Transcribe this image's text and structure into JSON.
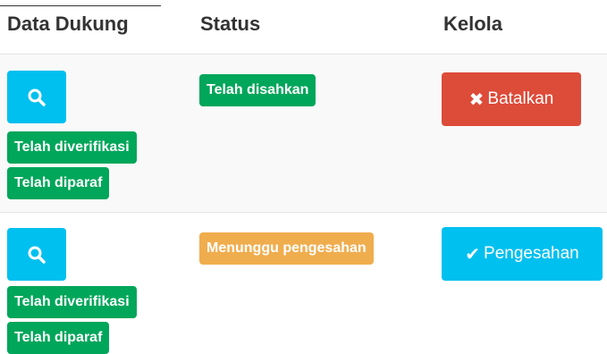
{
  "table": {
    "headers": [
      "Data Dukung",
      "Status",
      "Kelola"
    ],
    "rows": [
      {
        "verification_badges": [
          "Telah diverifikasi",
          "Telah diparaf"
        ],
        "status": "Telah disahkan",
        "status_color": "#00a65a",
        "action_label": "Batalkan",
        "action_icon": "times-icon",
        "action_color": "#dd4b39"
      },
      {
        "verification_badges": [
          "Telah diverifikasi",
          "Telah diparaf"
        ],
        "status": "Menunggu pengesahan",
        "status_color": "#f0ad4e",
        "action_label": "Pengesahan",
        "action_icon": "check-icon",
        "action_color": "#00c0ef"
      }
    ]
  },
  "colors": {
    "info": "#00c0ef",
    "success": "#00a65a",
    "warning": "#f0ad4e",
    "danger": "#dd4b39"
  }
}
